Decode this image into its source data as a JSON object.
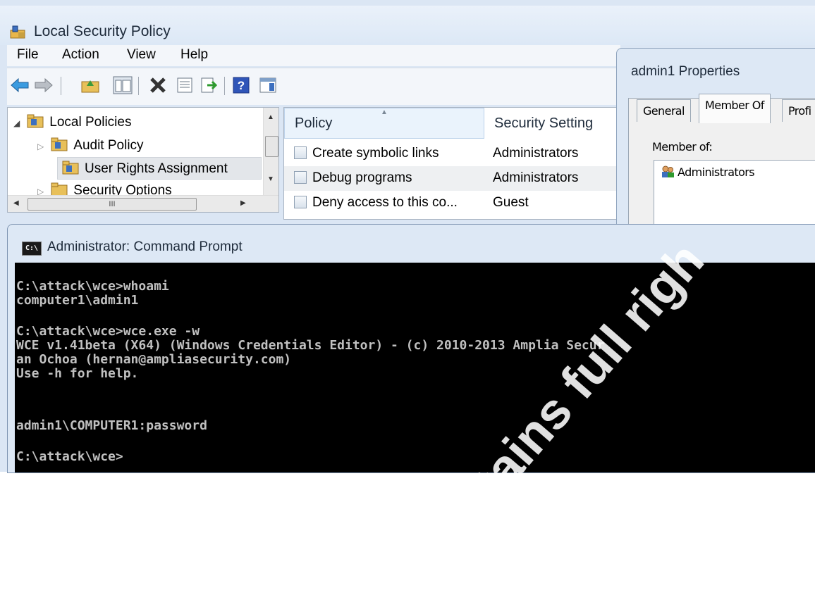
{
  "lsp": {
    "title": "Local Security Policy",
    "menu": [
      "File",
      "Action",
      "View",
      "Help"
    ],
    "tree": [
      "Local Policies",
      "Audit Policy",
      "User Rights Assignment",
      "Security Options"
    ],
    "hscroll_thumb": "III",
    "columns": [
      "Policy",
      "Security Setting"
    ],
    "rows": [
      {
        "policy": "Create symbolic links",
        "setting": "Administrators"
      },
      {
        "policy": "Debug programs",
        "setting": "Administrators"
      },
      {
        "policy": "Deny access to this co...",
        "setting": "Guest"
      }
    ]
  },
  "props": {
    "title": "admin1 Properties",
    "tabs": [
      "General",
      "Member Of",
      "Profi"
    ],
    "member_of_label": "Member of:",
    "members": [
      "Administrators"
    ]
  },
  "cmd": {
    "title": "Administrator: Command Prompt",
    "lines": [
      "C:\\attack\\wce>whoami",
      "computer1\\admin1",
      "",
      "C:\\attack\\wce>wce.exe -w",
      "WCE v1.41beta (X64) (Windows Credentials Editor) - (c) 2010-2013 Amplia Secur",
      "an Ochoa (hernan@ampliasecurity.com)",
      "Use -h for help.",
      "",
      "",
      "admin1\\COMPUTER1:password",
      "",
      "C:\\attack\\wce>"
    ]
  },
  "watermark": "or retains full righ"
}
